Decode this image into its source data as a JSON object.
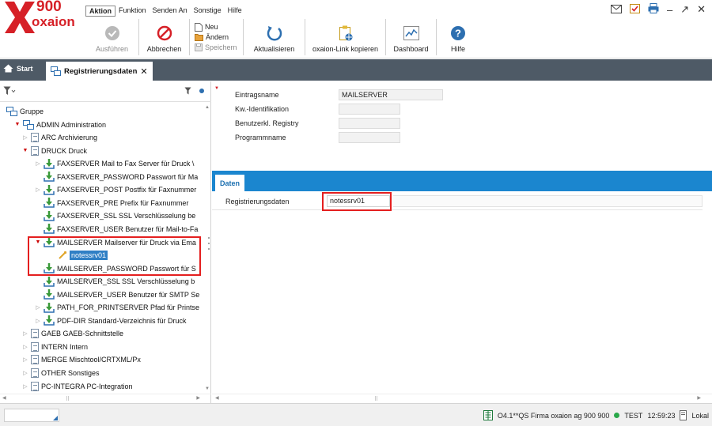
{
  "logo": {
    "number": "900",
    "name": "oxaion"
  },
  "menu": [
    "Aktion",
    "Funktion",
    "Senden An",
    "Sonstige",
    "Hilfe"
  ],
  "toolbar": {
    "ausfuehren": "Ausführen",
    "abbrechen": "Abbrechen",
    "neu": "Neu",
    "aendern": "Ändern",
    "speichern": "Speichern",
    "aktualisieren": "Aktualisieren",
    "oxaion_link": "oxaion-Link kopieren",
    "dashboard": "Dashboard",
    "hilfe": "Hilfe"
  },
  "tabs": {
    "start": "Start",
    "active": "Registrierungsdaten"
  },
  "tree": [
    {
      "label": "Gruppe",
      "level": 0,
      "icon": "group",
      "exp": ""
    },
    {
      "label": "ADMIN  Administration",
      "level": 1,
      "icon": "group",
      "exp": "open"
    },
    {
      "label": "ARC  Archivierung",
      "level": 2,
      "icon": "doc",
      "exp": "closed"
    },
    {
      "label": "DRUCK  Druck",
      "level": 2,
      "icon": "doc",
      "exp": "open"
    },
    {
      "label": "FAXSERVER  Mail to Fax Server für Druck \\",
      "level": 3,
      "icon": "arrow",
      "exp": "closed"
    },
    {
      "label": "FAXSERVER_PASSWORD  Passwort für Ma",
      "level": 3,
      "icon": "arrow",
      "exp": ""
    },
    {
      "label": "FAXSERVER_POST  Postfix für Faxnummer",
      "level": 3,
      "icon": "arrow",
      "exp": "closed"
    },
    {
      "label": "FAXSERVER_PRE  Prefix für Faxnummer",
      "level": 3,
      "icon": "arrow",
      "exp": ""
    },
    {
      "label": "FAXSERVER_SSL  SSL Verschlüsselung be",
      "level": 3,
      "icon": "arrow",
      "exp": ""
    },
    {
      "label": "FAXSERVER_USER  Benutzer für Mail-to-Fa",
      "level": 3,
      "icon": "arrow",
      "exp": ""
    },
    {
      "label": "MAILSERVER  Mailserver für Druck via Ema",
      "level": 3,
      "icon": "arrow",
      "exp": "open"
    },
    {
      "label": "notessrv01",
      "level": 4,
      "icon": "value",
      "exp": "",
      "selected": true
    },
    {
      "label": "MAILSERVER_PASSWORD  Passwort für S",
      "level": 3,
      "icon": "arrow",
      "exp": ""
    },
    {
      "label": "MAILSERVER_SSL  SSL Verschlüsselung b",
      "level": 3,
      "icon": "arrow",
      "exp": ""
    },
    {
      "label": "MAILSERVER_USER  Benutzer für SMTP Se",
      "level": 3,
      "icon": "arrow",
      "exp": ""
    },
    {
      "label": "PATH_FOR_PRINTSERVER  Pfad für Printse",
      "level": 3,
      "icon": "arrow",
      "exp": "closed"
    },
    {
      "label": "PDF-DIR  Standard-Verzeichnis für Druck",
      "level": 3,
      "icon": "arrow",
      "exp": "closed"
    },
    {
      "label": "GAEB  GAEB-Schnittstelle",
      "level": 2,
      "icon": "doc",
      "exp": "closed"
    },
    {
      "label": "INTERN  Intern",
      "level": 2,
      "icon": "doc",
      "exp": "closed"
    },
    {
      "label": "MERGE  Mischtool/CRTXML/Px",
      "level": 2,
      "icon": "doc",
      "exp": "closed"
    },
    {
      "label": "OTHER  Sonstiges",
      "level": 2,
      "icon": "doc",
      "exp": "closed"
    },
    {
      "label": "PC-INTEGRA  PC-Integration",
      "level": 2,
      "icon": "doc",
      "exp": "closed"
    }
  ],
  "form": {
    "eintragsname_label": "Eintragsname",
    "eintragsname_value": "MAILSERVER",
    "kw_label": "Kw.-Identifikation",
    "benutzer_label": "Benutzerkl. Registry",
    "programm_label": "Programmname"
  },
  "daten": {
    "tab_label": "Daten",
    "reg_label": "Registrierungsdaten",
    "reg_value": "notessrv01"
  },
  "status": {
    "company": "O4.1**QS Firma oxaion ag 900  900",
    "env": "TEST",
    "time": "12:59:23",
    "location": "Lokal"
  },
  "colors": {
    "brand": "#d62027",
    "accent": "#1b86cf",
    "tabbar": "#4e5a66",
    "highlight": "#e41f1f"
  }
}
